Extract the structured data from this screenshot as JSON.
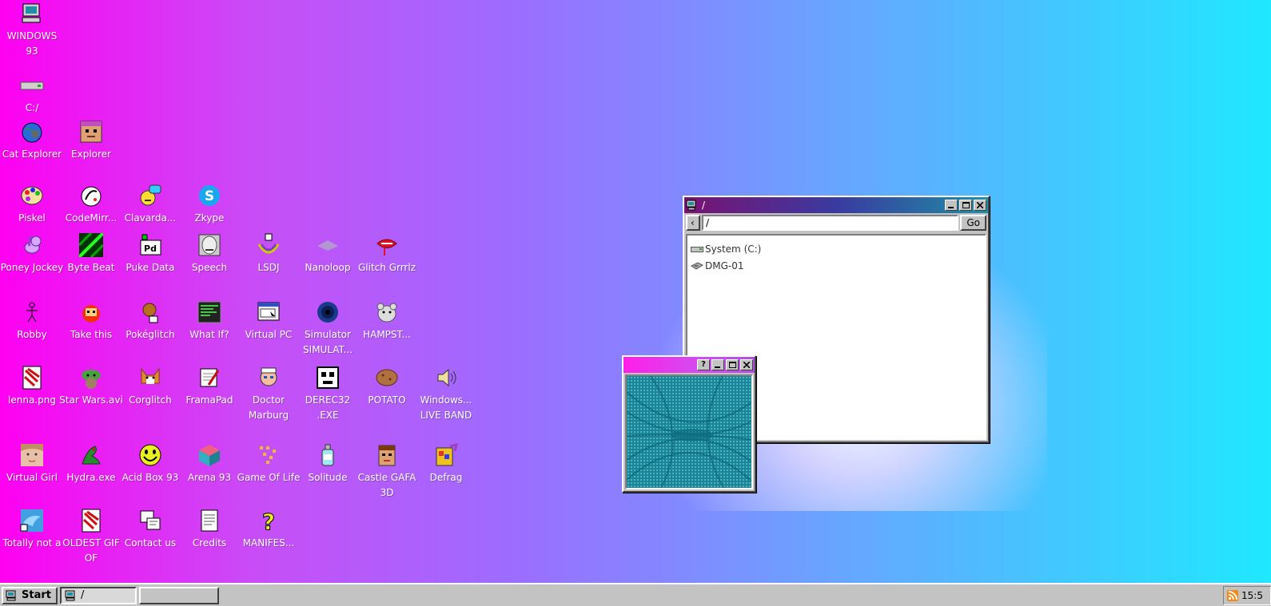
{
  "desktop_icons": [
    {
      "id": "windows93",
      "label": "WINDOWS 93",
      "icon": "computer-icon",
      "col": 0,
      "row": 0
    },
    {
      "id": "c-drive",
      "label": "C:/",
      "icon": "drive-icon",
      "col": 0,
      "row": 1
    },
    {
      "id": "cat-explorer",
      "label": "Cat Explorer",
      "icon": "globe-cat-icon",
      "col": 0,
      "row": 2
    },
    {
      "id": "explorer",
      "label": "Explorer",
      "icon": "explorer-face-icon",
      "col": 1,
      "row": 2
    },
    {
      "id": "piskel",
      "label": "Piskel",
      "icon": "palette-icon",
      "col": 0,
      "row": 3
    },
    {
      "id": "codemirror",
      "label": "CodeMirr...",
      "icon": "codemirror-icon",
      "col": 1,
      "row": 3
    },
    {
      "id": "clavardage",
      "label": "Clavarda...",
      "icon": "chat-face-icon",
      "col": 2,
      "row": 3
    },
    {
      "id": "zkype",
      "label": "Zkype",
      "icon": "zkype-icon",
      "col": 3,
      "row": 3
    },
    {
      "id": "poney",
      "label": "Poney Jockey",
      "icon": "pony-icon",
      "col": 0,
      "row": 4
    },
    {
      "id": "bytebeat",
      "label": "Byte Beat",
      "icon": "bytebeat-icon",
      "col": 1,
      "row": 4
    },
    {
      "id": "pukedata",
      "label": "Puke Data",
      "icon": "pd-icon",
      "col": 2,
      "row": 4
    },
    {
      "id": "speech",
      "label": "Speech",
      "icon": "speech-face-icon",
      "col": 3,
      "row": 4
    },
    {
      "id": "lsdj",
      "label": "LSDJ",
      "icon": "lsdj-icon",
      "col": 4,
      "row": 4
    },
    {
      "id": "nanoloop",
      "label": "Nanoloop",
      "icon": "nanoloop-icon",
      "col": 5,
      "row": 4
    },
    {
      "id": "glitchgrrrlz",
      "label": "Glitch Grrrlz",
      "icon": "lips-icon",
      "col": 6,
      "row": 4
    },
    {
      "id": "robby",
      "label": "Robby",
      "icon": "stickman-icon",
      "col": 0,
      "row": 5
    },
    {
      "id": "takethis",
      "label": "Take this",
      "icon": "take-this-icon",
      "col": 1,
      "row": 5
    },
    {
      "id": "pokeglitch",
      "label": "Pokéglitch",
      "icon": "pokeglitch-icon",
      "col": 2,
      "row": 5
    },
    {
      "id": "whatif",
      "label": "What If?",
      "icon": "terminal-icon",
      "col": 3,
      "row": 5
    },
    {
      "id": "virtualpc",
      "label": "Virtual PC",
      "icon": "virtual-pc-icon",
      "col": 4,
      "row": 5
    },
    {
      "id": "simulator",
      "label": "Simulator SIMULAT...",
      "icon": "vortex-icon",
      "col": 5,
      "row": 5
    },
    {
      "id": "hampster",
      "label": "HAMPST...",
      "icon": "hamster-icon",
      "col": 6,
      "row": 5
    },
    {
      "id": "lenna",
      "label": "lenna.png",
      "icon": "image-file-icon",
      "col": 0,
      "row": 6
    },
    {
      "id": "starwars",
      "label": "Star Wars.avi",
      "icon": "yoda-icon",
      "col": 1,
      "row": 6
    },
    {
      "id": "corglitch",
      "label": "Corglitch",
      "icon": "corgi-icon",
      "col": 2,
      "row": 6
    },
    {
      "id": "framapad",
      "label": "FramaPad",
      "icon": "notepad-pen-icon",
      "col": 3,
      "row": 6
    },
    {
      "id": "doctor",
      "label": "Doctor Marburg",
      "icon": "doctor-icon",
      "col": 4,
      "row": 6
    },
    {
      "id": "derec32",
      "label": "DEREC32 .EXE",
      "icon": "robot-face-icon",
      "col": 5,
      "row": 6
    },
    {
      "id": "potato",
      "label": "POTATO",
      "icon": "potato-icon",
      "col": 6,
      "row": 6
    },
    {
      "id": "liveband",
      "label": "Windows... LIVE BAND",
      "icon": "speaker-icon",
      "col": 7,
      "row": 6
    },
    {
      "id": "virtualgirl",
      "label": "Virtual Girl",
      "icon": "girl-face-icon",
      "col": 0,
      "row": 7
    },
    {
      "id": "hydra",
      "label": "Hydra.exe",
      "icon": "hydra-icon",
      "col": 1,
      "row": 7
    },
    {
      "id": "acidbox",
      "label": "Acid Box 93",
      "icon": "smiley-icon",
      "col": 2,
      "row": 7
    },
    {
      "id": "arena93",
      "label": "Arena 93",
      "icon": "cube-icon",
      "col": 3,
      "row": 7
    },
    {
      "id": "gameoflife",
      "label": "Game Of Life",
      "icon": "game-of-life-icon",
      "col": 4,
      "row": 7
    },
    {
      "id": "solitude",
      "label": "Solitude",
      "icon": "bottle-icon",
      "col": 5,
      "row": 7
    },
    {
      "id": "castle",
      "label": "Castle GAFA 3D",
      "icon": "castle-face-icon",
      "col": 6,
      "row": 7
    },
    {
      "id": "defrag",
      "label": "Defrag",
      "icon": "defrag-icon",
      "col": 7,
      "row": 7
    },
    {
      "id": "totally",
      "label": "Totally not a",
      "icon": "dolphin-icon",
      "col": 0,
      "row": 8
    },
    {
      "id": "oldestgif",
      "label": "OLDEST GIF OF",
      "icon": "gif-file-icon",
      "col": 1,
      "row": 8
    },
    {
      "id": "contact",
      "label": "Contact us",
      "icon": "contact-icon",
      "col": 2,
      "row": 8
    },
    {
      "id": "credits",
      "label": "Credits",
      "icon": "document-icon",
      "col": 3,
      "row": 8
    },
    {
      "id": "manifesto",
      "label": "MANIFES...",
      "icon": "question-icon",
      "col": 4,
      "row": 8
    }
  ],
  "explorer_window": {
    "title": "/",
    "path": "/",
    "go_label": "Go",
    "back_label": "‹",
    "items": [
      {
        "label": "System (C:)",
        "icon": "drive-icon"
      },
      {
        "label": "DMG-01",
        "icon": "disk-icon"
      }
    ]
  },
  "media_window": {
    "help_label": "?"
  },
  "taskbar": {
    "start_label": "Start",
    "tasks": [
      {
        "label": "/",
        "icon": "computer-icon"
      },
      {
        "label": "",
        "icon": ""
      }
    ],
    "clock": "15:5",
    "tray_icon": "rss-icon"
  },
  "colors": {
    "gradient_start": "#ff00f2",
    "gradient_end": "#1fe8ff",
    "window_face": "#c3c3c3",
    "title_start": "#7a1273",
    "title_end": "#1e8fa5"
  }
}
